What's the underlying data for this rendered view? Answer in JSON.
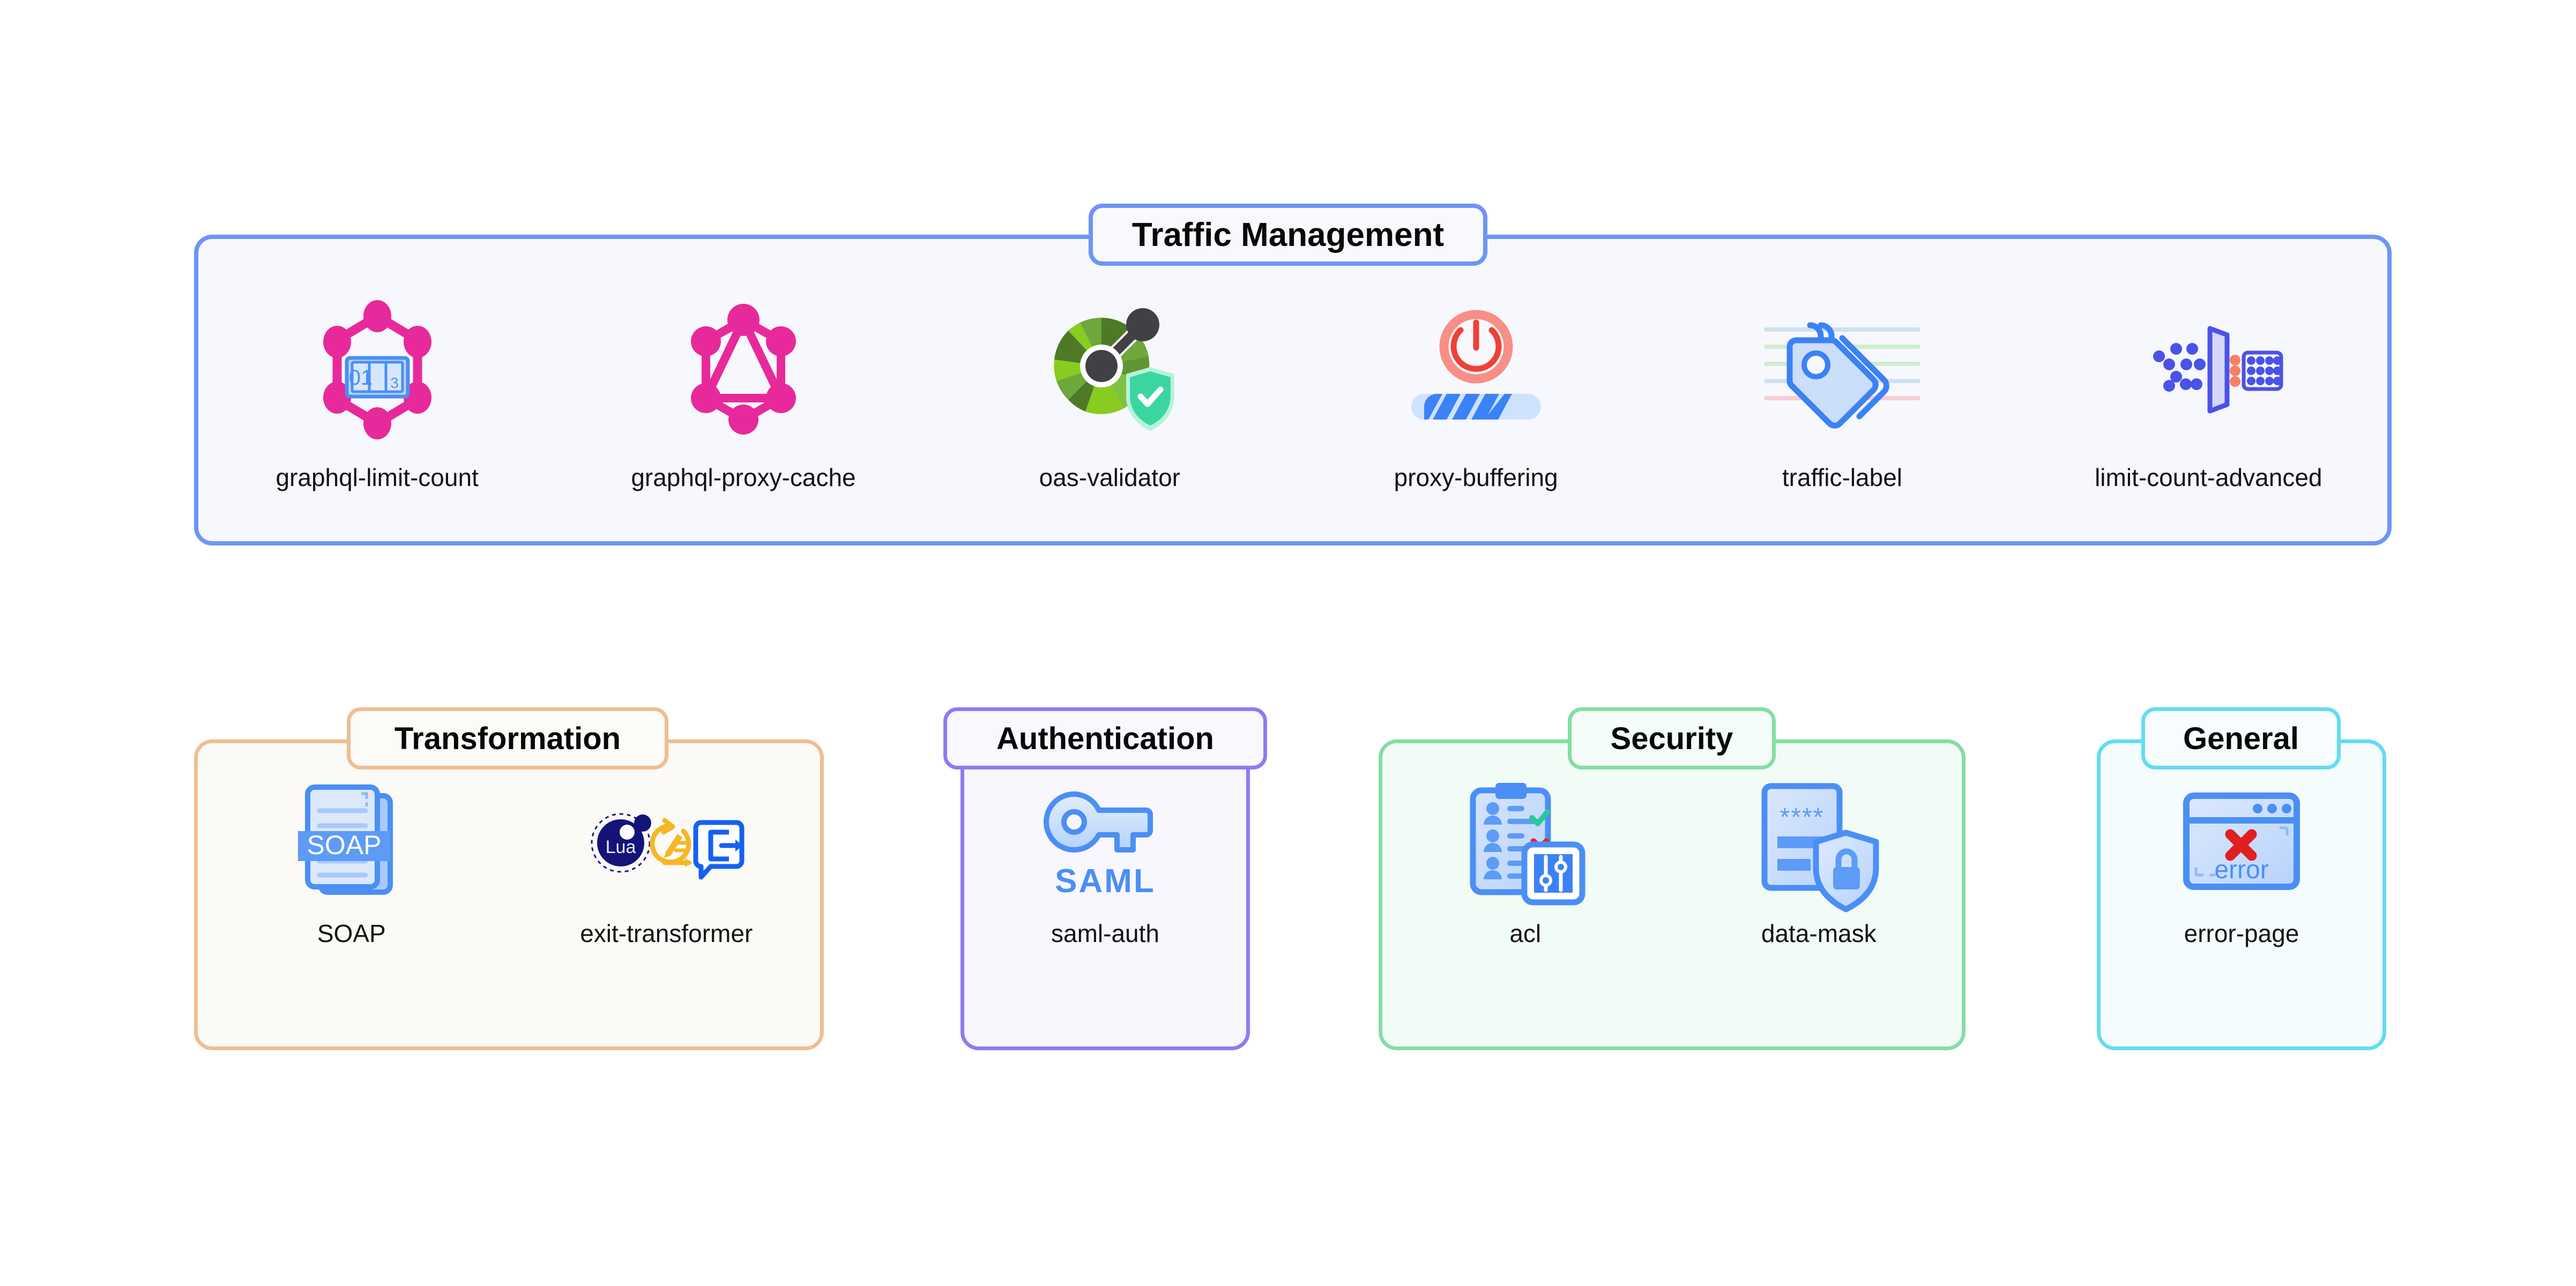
{
  "page": {
    "background": "#ffffff"
  },
  "sections": [
    {
      "id": "traffic",
      "title": "Traffic Management",
      "accent": "#6d94f7",
      "fill": "#f7f8fd",
      "plugins": [
        {
          "label": "graphql-limit-count",
          "icon": "graphql-counter-icon"
        },
        {
          "label": "graphql-proxy-cache",
          "icon": "graphql-logo-icon"
        },
        {
          "label": "oas-validator",
          "icon": "gauge-shield-check-icon"
        },
        {
          "label": "proxy-buffering",
          "icon": "power-buffer-icon"
        },
        {
          "label": "traffic-label",
          "icon": "price-tags-icon"
        },
        {
          "label": "limit-count-advanced",
          "icon": "dots-filter-grid-icon"
        }
      ]
    },
    {
      "id": "transformation",
      "title": "Transformation",
      "accent": "#efbe93",
      "fill": "#fcfaf7",
      "plugins": [
        {
          "label": "SOAP",
          "icon": "soap-document-icon"
        },
        {
          "label": "exit-transformer",
          "icon": "lua-exit-transformer-icon"
        }
      ]
    },
    {
      "id": "auth",
      "title": "Authentication",
      "accent": "#8b7cf6",
      "fill": "#f8f7fe",
      "plugins": [
        {
          "label": "saml-auth",
          "icon": "saml-key-icon"
        }
      ]
    },
    {
      "id": "security",
      "title": "Security",
      "accent": "#86dda6",
      "fill": "#f2fcf6",
      "plugins": [
        {
          "label": "acl",
          "icon": "acl-clipboard-sliders-icon"
        },
        {
          "label": "data-mask",
          "icon": "data-mask-shield-icon"
        }
      ]
    },
    {
      "id": "general",
      "title": "General",
      "accent": "#63dcf2",
      "fill": "#f5fcfe",
      "plugins": [
        {
          "label": "error-page",
          "icon": "error-browser-window-icon"
        }
      ]
    }
  ],
  "icon_text": {
    "counter_digits": "01",
    "counter_roll": "3",
    "soap": "SOAP",
    "saml": "SAML",
    "lua": "Lua",
    "mask_asterisks": "****",
    "error": "error"
  }
}
